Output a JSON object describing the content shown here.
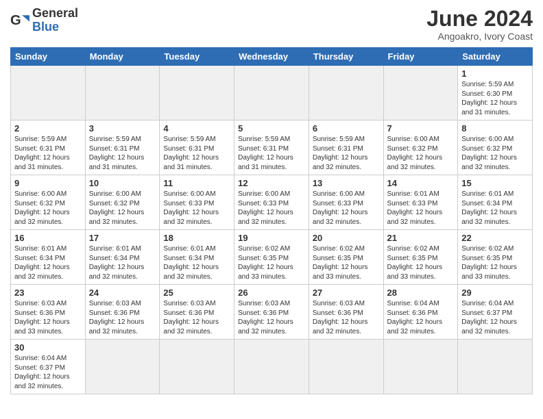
{
  "logo": {
    "general": "General",
    "blue": "Blue"
  },
  "header": {
    "title": "June 2024",
    "subtitle": "Angoakro, Ivory Coast"
  },
  "weekdays": [
    "Sunday",
    "Monday",
    "Tuesday",
    "Wednesday",
    "Thursday",
    "Friday",
    "Saturday"
  ],
  "weeks": [
    [
      {
        "day": "",
        "info": "",
        "empty": true
      },
      {
        "day": "",
        "info": "",
        "empty": true
      },
      {
        "day": "",
        "info": "",
        "empty": true
      },
      {
        "day": "",
        "info": "",
        "empty": true
      },
      {
        "day": "",
        "info": "",
        "empty": true
      },
      {
        "day": "",
        "info": "",
        "empty": true
      },
      {
        "day": "1",
        "info": "Sunrise: 5:59 AM\nSunset: 6:30 PM\nDaylight: 12 hours\nand 31 minutes.",
        "empty": false
      }
    ],
    [
      {
        "day": "2",
        "info": "Sunrise: 5:59 AM\nSunset: 6:31 PM\nDaylight: 12 hours\nand 31 minutes.",
        "empty": false
      },
      {
        "day": "3",
        "info": "Sunrise: 5:59 AM\nSunset: 6:31 PM\nDaylight: 12 hours\nand 31 minutes.",
        "empty": false
      },
      {
        "day": "4",
        "info": "Sunrise: 5:59 AM\nSunset: 6:31 PM\nDaylight: 12 hours\nand 31 minutes.",
        "empty": false
      },
      {
        "day": "5",
        "info": "Sunrise: 5:59 AM\nSunset: 6:31 PM\nDaylight: 12 hours\nand 31 minutes.",
        "empty": false
      },
      {
        "day": "6",
        "info": "Sunrise: 5:59 AM\nSunset: 6:31 PM\nDaylight: 12 hours\nand 32 minutes.",
        "empty": false
      },
      {
        "day": "7",
        "info": "Sunrise: 6:00 AM\nSunset: 6:32 PM\nDaylight: 12 hours\nand 32 minutes.",
        "empty": false
      },
      {
        "day": "8",
        "info": "Sunrise: 6:00 AM\nSunset: 6:32 PM\nDaylight: 12 hours\nand 32 minutes.",
        "empty": false
      }
    ],
    [
      {
        "day": "9",
        "info": "Sunrise: 6:00 AM\nSunset: 6:32 PM\nDaylight: 12 hours\nand 32 minutes.",
        "empty": false
      },
      {
        "day": "10",
        "info": "Sunrise: 6:00 AM\nSunset: 6:32 PM\nDaylight: 12 hours\nand 32 minutes.",
        "empty": false
      },
      {
        "day": "11",
        "info": "Sunrise: 6:00 AM\nSunset: 6:33 PM\nDaylight: 12 hours\nand 32 minutes.",
        "empty": false
      },
      {
        "day": "12",
        "info": "Sunrise: 6:00 AM\nSunset: 6:33 PM\nDaylight: 12 hours\nand 32 minutes.",
        "empty": false
      },
      {
        "day": "13",
        "info": "Sunrise: 6:00 AM\nSunset: 6:33 PM\nDaylight: 12 hours\nand 32 minutes.",
        "empty": false
      },
      {
        "day": "14",
        "info": "Sunrise: 6:01 AM\nSunset: 6:33 PM\nDaylight: 12 hours\nand 32 minutes.",
        "empty": false
      },
      {
        "day": "15",
        "info": "Sunrise: 6:01 AM\nSunset: 6:34 PM\nDaylight: 12 hours\nand 32 minutes.",
        "empty": false
      }
    ],
    [
      {
        "day": "16",
        "info": "Sunrise: 6:01 AM\nSunset: 6:34 PM\nDaylight: 12 hours\nand 32 minutes.",
        "empty": false
      },
      {
        "day": "17",
        "info": "Sunrise: 6:01 AM\nSunset: 6:34 PM\nDaylight: 12 hours\nand 32 minutes.",
        "empty": false
      },
      {
        "day": "18",
        "info": "Sunrise: 6:01 AM\nSunset: 6:34 PM\nDaylight: 12 hours\nand 32 minutes.",
        "empty": false
      },
      {
        "day": "19",
        "info": "Sunrise: 6:02 AM\nSunset: 6:35 PM\nDaylight: 12 hours\nand 33 minutes.",
        "empty": false
      },
      {
        "day": "20",
        "info": "Sunrise: 6:02 AM\nSunset: 6:35 PM\nDaylight: 12 hours\nand 33 minutes.",
        "empty": false
      },
      {
        "day": "21",
        "info": "Sunrise: 6:02 AM\nSunset: 6:35 PM\nDaylight: 12 hours\nand 33 minutes.",
        "empty": false
      },
      {
        "day": "22",
        "info": "Sunrise: 6:02 AM\nSunset: 6:35 PM\nDaylight: 12 hours\nand 33 minutes.",
        "empty": false
      }
    ],
    [
      {
        "day": "23",
        "info": "Sunrise: 6:03 AM\nSunset: 6:36 PM\nDaylight: 12 hours\nand 33 minutes.",
        "empty": false
      },
      {
        "day": "24",
        "info": "Sunrise: 6:03 AM\nSunset: 6:36 PM\nDaylight: 12 hours\nand 32 minutes.",
        "empty": false
      },
      {
        "day": "25",
        "info": "Sunrise: 6:03 AM\nSunset: 6:36 PM\nDaylight: 12 hours\nand 32 minutes.",
        "empty": false
      },
      {
        "day": "26",
        "info": "Sunrise: 6:03 AM\nSunset: 6:36 PM\nDaylight: 12 hours\nand 32 minutes.",
        "empty": false
      },
      {
        "day": "27",
        "info": "Sunrise: 6:03 AM\nSunset: 6:36 PM\nDaylight: 12 hours\nand 32 minutes.",
        "empty": false
      },
      {
        "day": "28",
        "info": "Sunrise: 6:04 AM\nSunset: 6:36 PM\nDaylight: 12 hours\nand 32 minutes.",
        "empty": false
      },
      {
        "day": "29",
        "info": "Sunrise: 6:04 AM\nSunset: 6:37 PM\nDaylight: 12 hours\nand 32 minutes.",
        "empty": false
      }
    ],
    [
      {
        "day": "30",
        "info": "Sunrise: 6:04 AM\nSunset: 6:37 PM\nDaylight: 12 hours\nand 32 minutes.",
        "empty": false
      },
      {
        "day": "",
        "info": "",
        "empty": true
      },
      {
        "day": "",
        "info": "",
        "empty": true
      },
      {
        "day": "",
        "info": "",
        "empty": true
      },
      {
        "day": "",
        "info": "",
        "empty": true
      },
      {
        "day": "",
        "info": "",
        "empty": true
      },
      {
        "day": "",
        "info": "",
        "empty": true
      }
    ]
  ]
}
